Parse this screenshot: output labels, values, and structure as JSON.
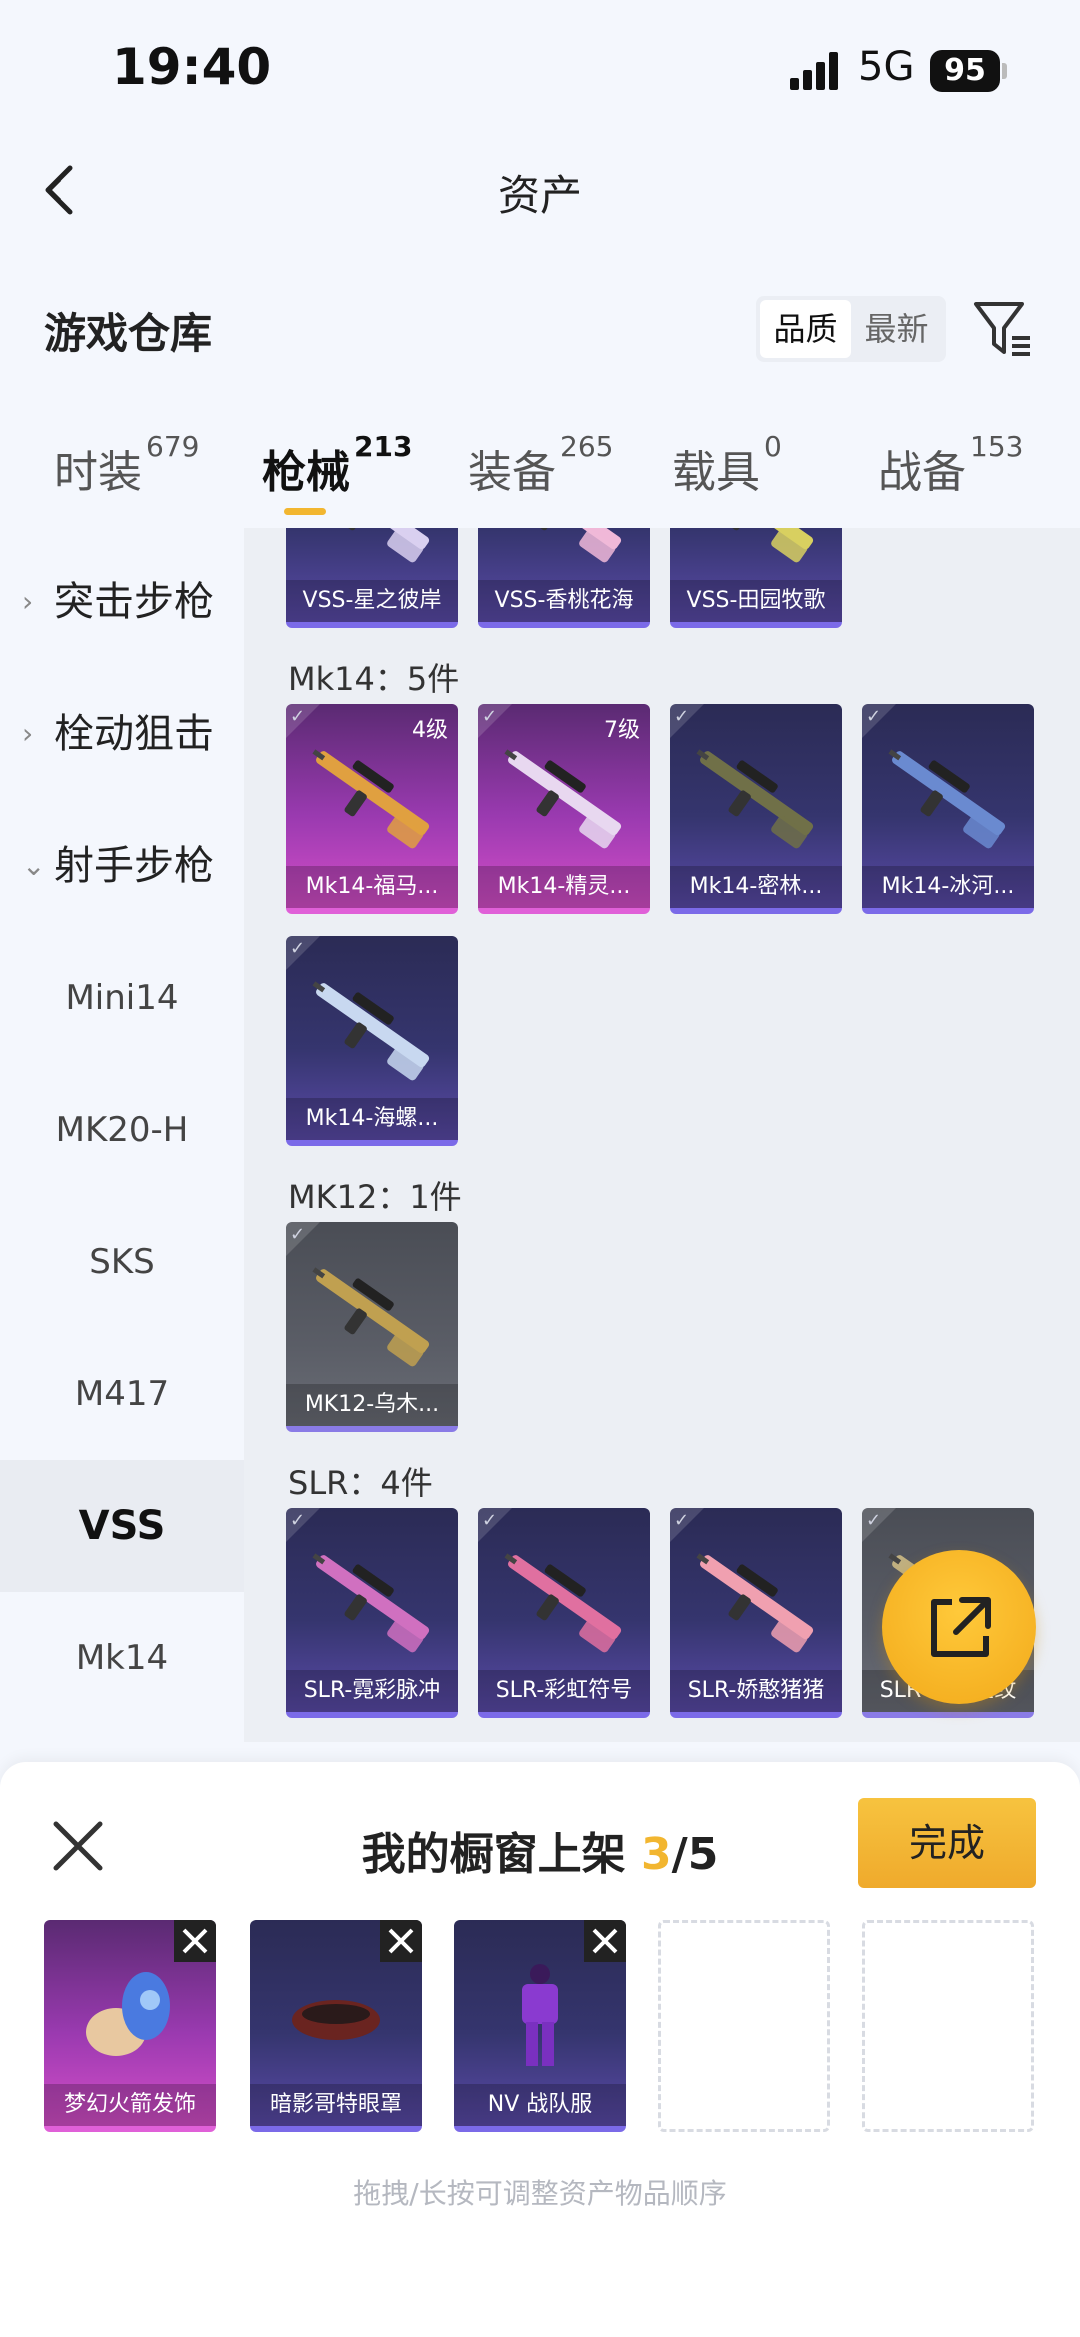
{
  "status_bar": {
    "time": "19:40",
    "network": "5G",
    "battery": "95"
  },
  "nav": {
    "title": "资产",
    "back_icon": "back-chevron-icon"
  },
  "warehouse": {
    "title": "游戏仓库",
    "sort_options": [
      "品质",
      "最新"
    ],
    "sort_selected": "品质",
    "filter_icon": "filter-icon"
  },
  "tabs": [
    {
      "label": "时装",
      "count": "679",
      "active": false
    },
    {
      "label": "枪械",
      "count": "213",
      "active": true
    },
    {
      "label": "装备",
      "count": "265",
      "active": false
    },
    {
      "label": "载具",
      "count": "0",
      "active": false
    },
    {
      "label": "战备",
      "count": "153",
      "active": false
    }
  ],
  "sidebar": {
    "items": [
      {
        "label": "突击步枪",
        "type": "group",
        "chevron": "›"
      },
      {
        "label": "栓动狙击",
        "type": "group",
        "chevron": "›"
      },
      {
        "label": "射手步枪",
        "type": "group",
        "chevron": "⌄"
      },
      {
        "label": "Mini14",
        "type": "item"
      },
      {
        "label": "MK20-H",
        "type": "item"
      },
      {
        "label": "SKS",
        "type": "item"
      },
      {
        "label": "M417",
        "type": "item"
      },
      {
        "label": "VSS",
        "type": "item",
        "selected": true
      },
      {
        "label": "Mk14",
        "type": "item"
      }
    ]
  },
  "groups": [
    {
      "heading": "",
      "items": [
        {
          "name": "VSS-星之彼岸",
          "rarity": "blue"
        },
        {
          "name": "VSS-香桃花海",
          "rarity": "blue"
        },
        {
          "name": "VSS-田园牧歌",
          "rarity": "blue"
        }
      ]
    },
    {
      "heading": "Mk14：5件",
      "items": [
        {
          "name": "Mk14-福马...",
          "rarity": "pink",
          "level": "4级"
        },
        {
          "name": "Mk14-精灵...",
          "rarity": "pink",
          "level": "7级"
        },
        {
          "name": "Mk14-密林...",
          "rarity": "blue"
        },
        {
          "name": "Mk14-冰河...",
          "rarity": "blue"
        },
        {
          "name": "Mk14-海螺...",
          "rarity": "blue"
        }
      ]
    },
    {
      "heading": "MK12：1件",
      "items": [
        {
          "name": "MK12-乌木...",
          "rarity": "gray"
        }
      ]
    },
    {
      "heading": "SLR：4件",
      "items": [
        {
          "name": "SLR-霓彩脉冲",
          "rarity": "blue"
        },
        {
          "name": "SLR-彩虹符号",
          "rarity": "blue"
        },
        {
          "name": "SLR-娇憨猪猪",
          "rarity": "blue"
        },
        {
          "name": "SLR-乌木金纹",
          "rarity": "gray"
        }
      ]
    }
  ],
  "fab": {
    "icon": "share-icon"
  },
  "showcase": {
    "title_prefix": "我的橱窗上架",
    "count": "3",
    "total": "/5",
    "done_label": "完成",
    "close_icon": "close-icon",
    "slots": [
      {
        "name": "梦幻火箭发饰",
        "rarity": "pink"
      },
      {
        "name": "暗影哥特眼罩",
        "rarity": "blue"
      },
      {
        "name": "NV 战队服",
        "rarity": "blue"
      },
      {
        "name": "",
        "rarity": "empty"
      },
      {
        "name": "",
        "rarity": "empty"
      }
    ],
    "hint": "拖拽/长按可调整资产物品顺序"
  },
  "colors": {
    "accent": "#f2b630",
    "blue_card": "#35356e",
    "pink_card": "#9a3ab0"
  }
}
